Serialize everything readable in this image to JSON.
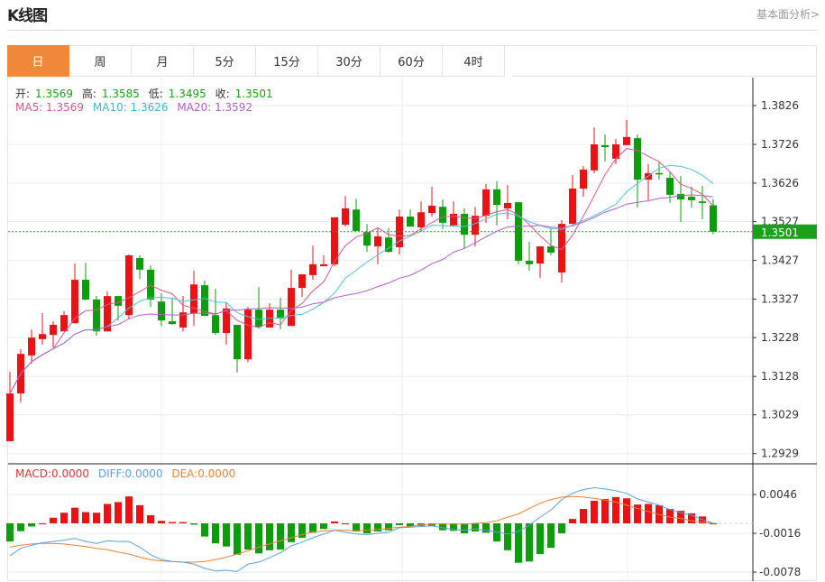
{
  "header": {
    "title": "K线图",
    "link": "基本面分析>"
  },
  "tabs": [
    {
      "label": "日",
      "active": true
    },
    {
      "label": "周"
    },
    {
      "label": "月"
    },
    {
      "label": "5分"
    },
    {
      "label": "15分"
    },
    {
      "label": "30分"
    },
    {
      "label": "60分"
    },
    {
      "label": "4时"
    }
  ],
  "ohlc_legend": {
    "open_label": "开:",
    "open": "1.3569",
    "high_label": "高:",
    "high": "1.3585",
    "low_label": "低:",
    "low": "1.3495",
    "close_label": "收:",
    "close": "1.3501"
  },
  "ma_legend": {
    "ma5": "MA5: 1.3569",
    "ma10": "MA10: 1.3626",
    "ma20": "MA20: 1.3592"
  },
  "macd_legend": {
    "macd": "MACD:0.0000",
    "diff": "DIFF:0.0000",
    "dea": "DEA:0.0000"
  },
  "last_price": "1.3501",
  "colors": {
    "up": "#ee1111",
    "down": "#0a9e0a",
    "ma5": "#e0558a",
    "ma10": "#4cc3d9",
    "ma20": "#b25fc7",
    "diff": "#5aa0e0",
    "dea": "#f08030",
    "accent": "#f0883a",
    "last_price": "#1aa01a"
  },
  "chart_data": [
    {
      "type": "candlestick",
      "y_ticks": [
        "1.3826",
        "1.3726",
        "1.3626",
        "1.3527",
        "1.3427",
        "1.3327",
        "1.3228",
        "1.3128",
        "1.3029",
        "1.2929"
      ],
      "ylim": [
        1.2925,
        1.39
      ],
      "grid": true,
      "ma_periods": [
        5,
        10,
        20
      ],
      "candles": [
        [
          1.2961,
          1.314,
          1.2961,
          1.3084
        ],
        [
          1.3084,
          1.3198,
          1.3061,
          1.3186
        ],
        [
          1.3182,
          1.3249,
          1.3161,
          1.3228
        ],
        [
          1.3224,
          1.3291,
          1.321,
          1.3237
        ],
        [
          1.3235,
          1.327,
          1.3203,
          1.3261
        ],
        [
          1.3244,
          1.3296,
          1.3244,
          1.3286
        ],
        [
          1.3265,
          1.3419,
          1.3265,
          1.3377
        ],
        [
          1.3377,
          1.3421,
          1.3324,
          1.3326
        ],
        [
          1.3326,
          1.3335,
          1.3233,
          1.3244
        ],
        [
          1.3244,
          1.3347,
          1.3244,
          1.3335
        ],
        [
          1.3335,
          1.3335,
          1.3272,
          1.331
        ],
        [
          1.3286,
          1.3442,
          1.3277,
          1.344
        ],
        [
          1.3433,
          1.344,
          1.3379,
          1.3403
        ],
        [
          1.3403,
          1.3414,
          1.3307,
          1.3326
        ],
        [
          1.3321,
          1.3342,
          1.3258,
          1.3272
        ],
        [
          1.327,
          1.3331,
          1.3261,
          1.3263
        ],
        [
          1.3254,
          1.3335,
          1.3244,
          1.3293
        ],
        [
          1.3291,
          1.34,
          1.3258,
          1.3365
        ],
        [
          1.3363,
          1.3375,
          1.3284,
          1.3284
        ],
        [
          1.3286,
          1.3354,
          1.3235,
          1.324
        ],
        [
          1.324,
          1.3319,
          1.321,
          1.3303
        ],
        [
          1.3261,
          1.3261,
          1.3138,
          1.3172
        ],
        [
          1.3172,
          1.3307,
          1.3165,
          1.33
        ],
        [
          1.33,
          1.3358,
          1.3251,
          1.3256
        ],
        [
          1.3254,
          1.3317,
          1.3254,
          1.33
        ],
        [
          1.33,
          1.3331,
          1.3249,
          1.3277
        ],
        [
          1.3258,
          1.3403,
          1.3258,
          1.3356
        ],
        [
          1.3356,
          1.3391,
          1.3333,
          1.3391
        ],
        [
          1.3389,
          1.3465,
          1.3377,
          1.3417
        ],
        [
          1.3412,
          1.344,
          1.3412,
          1.3417
        ],
        [
          1.3417,
          1.3538,
          1.3412,
          1.3538
        ],
        [
          1.3519,
          1.3593,
          1.3514,
          1.3561
        ],
        [
          1.3558,
          1.3586,
          1.3503,
          1.3503
        ],
        [
          1.35,
          1.3521,
          1.3449,
          1.3465
        ],
        [
          1.3463,
          1.351,
          1.3417,
          1.3489
        ],
        [
          1.3486,
          1.351,
          1.3447,
          1.3449
        ],
        [
          1.3461,
          1.3558,
          1.3442,
          1.354
        ],
        [
          1.354,
          1.3558,
          1.3514,
          1.3514
        ],
        [
          1.3512,
          1.3579,
          1.35,
          1.3551
        ],
        [
          1.3549,
          1.3617,
          1.354,
          1.3568
        ],
        [
          1.3565,
          1.3584,
          1.3507,
          1.3524
        ],
        [
          1.3517,
          1.3579,
          1.3517,
          1.3547
        ],
        [
          1.3547,
          1.3561,
          1.3456,
          1.3493
        ],
        [
          1.3493,
          1.3565,
          1.3463,
          1.3542
        ],
        [
          1.3542,
          1.3624,
          1.3524,
          1.361
        ],
        [
          1.361,
          1.3631,
          1.3517,
          1.357
        ],
        [
          1.3561,
          1.3621,
          1.3533,
          1.3575
        ],
        [
          1.3577,
          1.3577,
          1.3417,
          1.3426
        ],
        [
          1.3426,
          1.3475,
          1.34,
          1.3417
        ],
        [
          1.3419,
          1.3463,
          1.3382,
          1.3463
        ],
        [
          1.3463,
          1.351,
          1.344,
          1.3447
        ],
        [
          1.3396,
          1.3531,
          1.337,
          1.3521
        ],
        [
          1.3521,
          1.3647,
          1.3521,
          1.3612
        ],
        [
          1.3612,
          1.367,
          1.3591,
          1.3661
        ],
        [
          1.3659,
          1.377,
          1.3652,
          1.3726
        ],
        [
          1.3724,
          1.3752,
          1.3682,
          1.3719
        ],
        [
          1.3689,
          1.374,
          1.3675,
          1.3726
        ],
        [
          1.3724,
          1.3789,
          1.3724,
          1.3745
        ],
        [
          1.3742,
          1.3752,
          1.3563,
          1.3635
        ],
        [
          1.3635,
          1.3675,
          1.3582,
          1.3652
        ],
        [
          1.3652,
          1.3679,
          1.3635,
          1.3649
        ],
        [
          1.364,
          1.3656,
          1.3575,
          1.3596
        ],
        [
          1.3598,
          1.3645,
          1.3526,
          1.3584
        ],
        [
          1.3591,
          1.3617,
          1.3563,
          1.3582
        ],
        [
          1.3579,
          1.3619,
          1.3533,
          1.3575
        ],
        [
          1.3569,
          1.3585,
          1.3495,
          1.3501
        ]
      ]
    },
    {
      "type": "bar+line",
      "y_ticks": [
        "0.0046",
        "-0.0016",
        "-0.0078"
      ],
      "ylim": [
        -0.0078,
        0.0046
      ],
      "macd": [
        -0.0029,
        -0.00125,
        -0.0005,
        0,
        0.0009,
        0.0017,
        0.0025,
        0.0018,
        0.0017,
        0.0031,
        0.0034,
        0.0043,
        0.0029,
        0.0013,
        0.0004,
        0.0002,
        0.0002,
        -0.0002,
        -0.0021,
        -0.0032,
        -0.0037,
        -0.005,
        -0.0042,
        -0.0048,
        -0.0043,
        -0.0042,
        -0.003,
        -0.0023,
        -0.0015,
        -0.0009,
        0.0003,
        0,
        -0.0013,
        -0.0016,
        -0.0013,
        -0.0011,
        -0.0003,
        -0.0005,
        -0.0004,
        -0.0004,
        -0.0011,
        -0.0012,
        -0.0016,
        -0.0013,
        -0.0015,
        -0.0029,
        -0.0043,
        -0.0063,
        -0.0061,
        -0.0049,
        -0.0039,
        -0.0016,
        0.0007,
        0.0023,
        0.0036,
        0.0039,
        0.0042,
        0.004,
        0.003,
        0.0031,
        0.0029,
        0.0023,
        0.002,
        0.0016,
        0.0011,
        0
      ],
      "diff": [
        -0.0052,
        -0.004,
        -0.0035,
        -0.0031,
        -0.0029,
        -0.0027,
        -0.0024,
        -0.0029,
        -0.0032,
        -0.0028,
        -0.0029,
        -0.0029,
        -0.0038,
        -0.005,
        -0.0058,
        -0.0061,
        -0.0062,
        -0.0065,
        -0.0072,
        -0.0076,
        -0.0075,
        -0.0077,
        -0.0065,
        -0.0062,
        -0.0055,
        -0.0047,
        -0.0036,
        -0.003,
        -0.0023,
        -0.0017,
        -0.0011,
        -0.0014,
        -0.0017,
        -0.0018,
        -0.0016,
        -0.0014,
        -0.0007,
        -0.0006,
        -0.0005,
        -0.0004,
        -0.0007,
        -0.001,
        -0.0011,
        -0.0009,
        -0.0011,
        -0.0014,
        -0.0017,
        -0.0013,
        -0.0003,
        0.001,
        0.0021,
        0.0038,
        0.0048,
        0.0054,
        0.0057,
        0.0055,
        0.0052,
        0.0048,
        0.0039,
        0.0034,
        0.0029,
        0.0022,
        0.0017,
        0.0013,
        0.0006,
        0
      ],
      "dea": [
        -0.0038,
        -0.0035,
        -0.0033,
        -0.0032,
        -0.0032,
        -0.0033,
        -0.0035,
        -0.0037,
        -0.004,
        -0.0042,
        -0.0046,
        -0.0049,
        -0.0054,
        -0.0058,
        -0.006,
        -0.0061,
        -0.0062,
        -0.0062,
        -0.0061,
        -0.0058,
        -0.0054,
        -0.0049,
        -0.0044,
        -0.0038,
        -0.0033,
        -0.0028,
        -0.0023,
        -0.0018,
        -0.0014,
        -0.0012,
        -0.0011,
        -0.0011,
        -0.0012,
        -0.0011,
        -0.001,
        -0.0008,
        -0.0006,
        -0.0005,
        -0.0002,
        -0.0001,
        -0.0001,
        -0.0001,
        -0.0001,
        0,
        0.0001,
        0.0004,
        0.001,
        0.0015,
        0.0024,
        0.0032,
        0.0038,
        0.0042,
        0.0043,
        0.0042,
        0.004,
        0.0037,
        0.0034,
        0.0029,
        0.0024,
        0.0019,
        0.0014,
        0.001,
        0.0008,
        0.0004,
        0.0002,
        0
      ]
    }
  ]
}
